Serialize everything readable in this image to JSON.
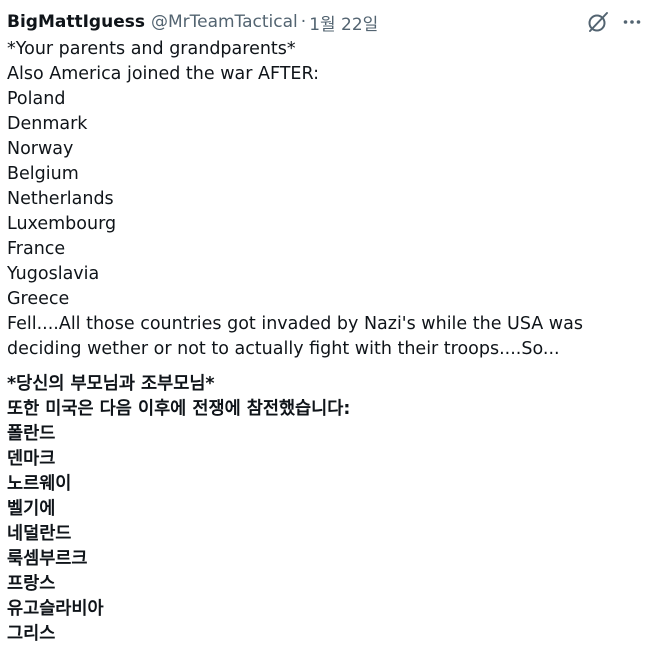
{
  "tweet": {
    "display_name": "BigMattIguess",
    "handle": "@MrTeamTactical",
    "separator": "·",
    "date": "1월 22일",
    "actions": [
      {
        "icon": "grok-icon"
      },
      {
        "icon": "more-icon"
      }
    ],
    "body_lines": [
      "*Your parents and grandparents*",
      "Also America joined the war AFTER:",
      "Poland",
      "Denmark",
      "Norway",
      "Belgium",
      "Netherlands",
      "Luxembourg",
      "France",
      "Yugoslavia",
      "Greece"
    ],
    "body_closing": "Fell....All those countries got invaded by Nazi's while the USA was deciding wether or not to actually fight with their troops....So...",
    "translation_lines": [
      "*당신의 부모님과 조부모님*",
      "또한 미국은 다음 이후에 전쟁에 참전했습니다:",
      "폴란드",
      "덴마크",
      "노르웨이",
      "벨기에",
      "네덜란드",
      "룩셈부르크",
      "프랑스",
      "유고슬라비아",
      "그리스"
    ]
  },
  "colors": {
    "text": "#0f1419",
    "secondary": "#536471",
    "background": "#ffffff"
  }
}
